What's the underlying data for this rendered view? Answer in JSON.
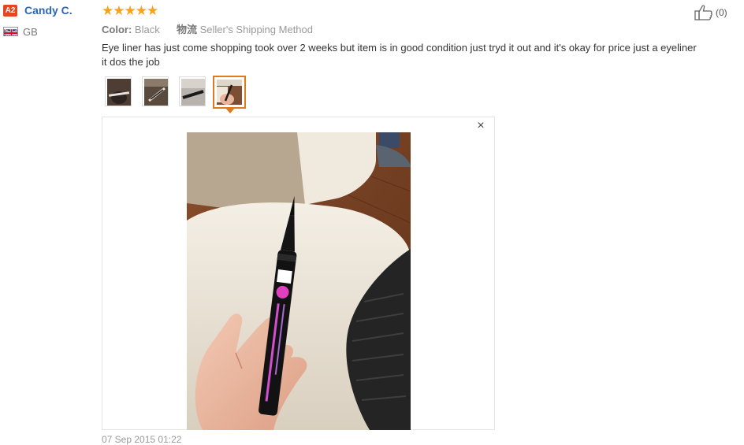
{
  "reviewer": {
    "badge": "A2",
    "name": "Candy C.",
    "country": "GB"
  },
  "review": {
    "rating": 5,
    "stars_text": "★★★★★",
    "color_label": "Color:",
    "color_value": "Black",
    "shipping_label": "物流",
    "shipping_value": "Seller's Shipping Method",
    "text": "Eye liner has just come shopping took over 2 weeks but item is in good condition just tryd it out and it's okay for price just a eyeliner it dos the job",
    "helpful_count": "(0)",
    "date": "07 Sep 2015 01:22"
  },
  "gallery": {
    "thumbnail_count": 4,
    "active_index": 3,
    "close_symbol": "×"
  },
  "colors": {
    "accent": "#e07a1f",
    "star": "#f7a21b",
    "link": "#2b67b6",
    "badge": "#e5461f"
  }
}
